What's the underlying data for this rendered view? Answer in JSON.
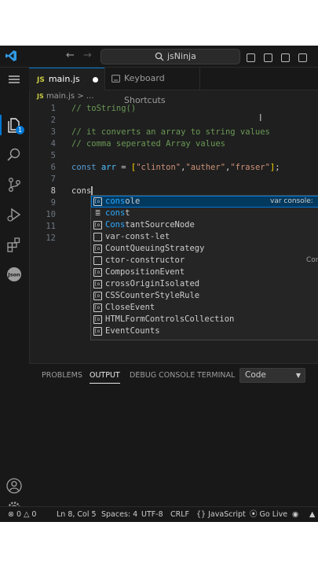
{
  "titlebar": {
    "search_text": "jsNinja"
  },
  "activity": {
    "explorer_badge": "1"
  },
  "tabs": [
    {
      "label": "main.js",
      "icon_text": "JS"
    },
    {
      "label": "Keyboard Shortcuts"
    }
  ],
  "breadcrumb": {
    "file_icon": "JS",
    "file": "main.js",
    "sep": ">",
    "rest": "..."
  },
  "editor": {
    "lines": [
      {
        "num": "1",
        "tokens": [
          [
            "com",
            "// toString()"
          ]
        ]
      },
      {
        "num": "2",
        "tokens": []
      },
      {
        "num": "3",
        "tokens": [
          [
            "com",
            "// it converts an array to string values"
          ]
        ]
      },
      {
        "num": "4",
        "tokens": [
          [
            "com",
            "// comma seperated Array values"
          ]
        ]
      },
      {
        "num": "5",
        "tokens": []
      },
      {
        "num": "6",
        "tokens": [
          [
            "kw",
            "const"
          ],
          [
            "op",
            " "
          ],
          [
            "var",
            "arr"
          ],
          [
            "op",
            " = "
          ],
          [
            "br",
            "["
          ],
          [
            "str",
            "\"clinton\""
          ],
          [
            "op",
            ","
          ],
          [
            "str",
            "\"auther\""
          ],
          [
            "op",
            ","
          ],
          [
            "str",
            "\"fraser\""
          ],
          [
            "br",
            "]"
          ],
          [
            "op",
            ";"
          ]
        ]
      },
      {
        "num": "7",
        "tokens": []
      },
      {
        "num": "8",
        "tokens": [
          [
            "op",
            "cons"
          ]
        ],
        "current": true
      },
      {
        "num": "9",
        "tokens": []
      },
      {
        "num": "10",
        "tokens": []
      },
      {
        "num": "11",
        "tokens": []
      },
      {
        "num": "12",
        "tokens": []
      }
    ]
  },
  "suggestions": [
    {
      "icon": "var",
      "label": "console",
      "match": "cons",
      "detail": "var console:",
      "selected": true
    },
    {
      "icon": "kw",
      "label": "const",
      "match": "cons"
    },
    {
      "icon": "var",
      "label": "ConstantSourceNode",
      "match": "Cons"
    },
    {
      "icon": "snip",
      "label": "var-const-let",
      "match": ""
    },
    {
      "icon": "var",
      "label": "CountQueuingStrategy",
      "match": ""
    },
    {
      "icon": "snip",
      "label": "ctor-constructor",
      "match": "",
      "detail2": "Con"
    },
    {
      "icon": "var",
      "label": "CompositionEvent",
      "match": ""
    },
    {
      "icon": "var",
      "label": "crossOriginIsolated",
      "match": ""
    },
    {
      "icon": "var",
      "label": "CSSCounterStyleRule",
      "match": ""
    },
    {
      "icon": "var",
      "label": "CloseEvent",
      "match": ""
    },
    {
      "icon": "var",
      "label": "HTMLFormControlsCollection",
      "match": ""
    },
    {
      "icon": "var",
      "label": "EventCounts",
      "match": ""
    }
  ],
  "panel": {
    "tabs": [
      "PROBLEMS",
      "OUTPUT",
      "DEBUG CONSOLE",
      "TERMINAL"
    ],
    "active_tab": "OUTPUT",
    "select_value": "Code"
  },
  "status": {
    "errors": "0",
    "warnings": "0",
    "position": "Ln 8, Col 5",
    "spaces": "Spaces: 4",
    "encoding": "UTF-8",
    "eol": "CRLF",
    "language": "JavaScript",
    "live": "Go Live"
  }
}
